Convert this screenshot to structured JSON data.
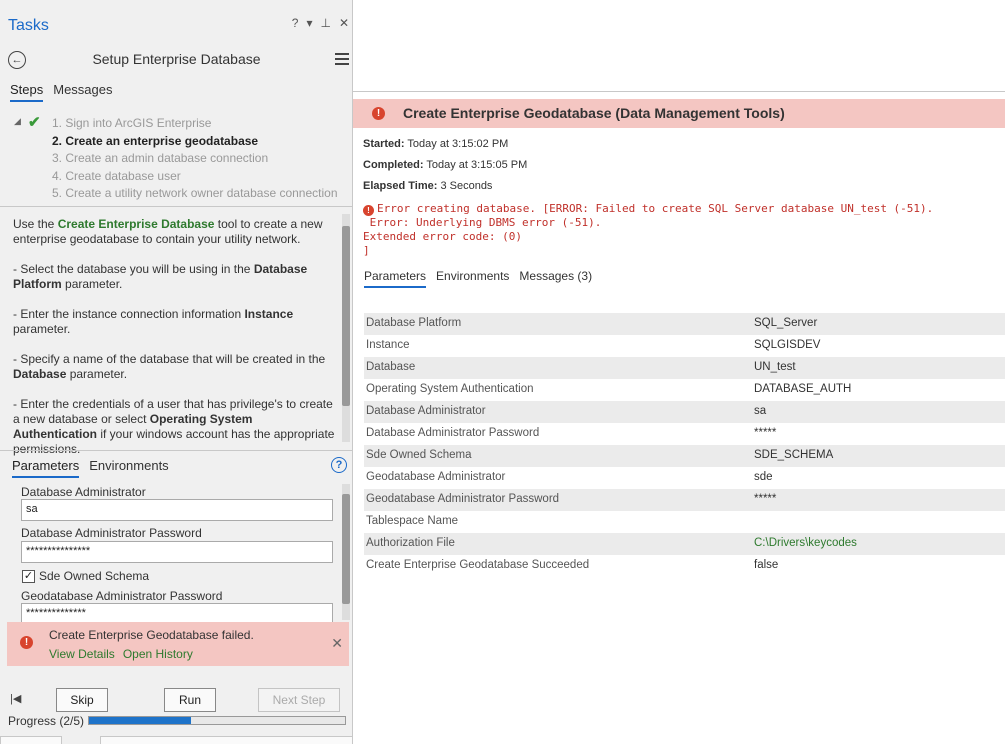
{
  "tasks_pane": {
    "title": "Tasks",
    "header_icons": [
      "?",
      "▾",
      "⊥",
      "✕"
    ],
    "task_title": "Setup Enterprise Database",
    "tabs": [
      "Steps",
      "Messages"
    ],
    "steps": [
      {
        "label": "1.  Sign into ArcGIS Enterprise",
        "state": "done"
      },
      {
        "label": "2.  Create an enterprise geodatabase",
        "state": "current"
      },
      {
        "label": "3.  Create an admin database connection",
        "state": "pending"
      },
      {
        "label": "4.  Create database user",
        "state": "pending"
      },
      {
        "label": "5.  Create a utility network owner database connection",
        "state": "pending"
      }
    ],
    "description": {
      "p1_a": "Use the ",
      "p1_tool": "Create Enterprise Database",
      "p1_b": " tool to create a new enterprise geodatabase to contain your utility network.",
      "p2_a": "- Select the database you will be using in the ",
      "p2_b": "Database Platform",
      "p2_c": " parameter.",
      "p3_a": "- Enter the instance connection information ",
      "p3_b": "Instance",
      "p3_c": " parameter.",
      "p4_a": "- Specify a name of the database that will be created in the ",
      "p4_b": "Database",
      "p4_c": " parameter.",
      "p5_a": "- Enter the credentials of a user that has privilege's to create a new database or select ",
      "p5_b": "Operating System Authentication",
      "p5_c": " if your windows account has the appropriate permissions."
    },
    "param_tabs": [
      "Parameters",
      "Environments"
    ],
    "help_glyph": "?",
    "params": {
      "db_admin_label": "Database Administrator",
      "db_admin_value": "sa",
      "db_admin_pw_label": "Database Administrator Password",
      "db_admin_pw_value": "***************",
      "sde_schema_label": "Sde Owned Schema",
      "sde_schema_checked": "✓",
      "gdb_admin_pw_label": "Geodatabase Administrator Password",
      "gdb_admin_pw_value": "**************"
    },
    "error_banner": {
      "message": "Create Enterprise Geodatabase failed.",
      "view_details": "View Details",
      "open_history": "Open History",
      "close": "✕",
      "icon": "!"
    },
    "buttons": {
      "first": "|◀",
      "skip": "Skip",
      "run": "Run",
      "next": "Next Step"
    },
    "progress": {
      "label": "Progress (2/5)",
      "fraction": 0.4
    }
  },
  "result_pane": {
    "icon": "!",
    "title": "Create Enterprise Geodatabase (Data Management Tools)",
    "started_label": "Started:",
    "started_value": "Today at 3:15:02 PM",
    "completed_label": "Completed:",
    "completed_value": "Today at 3:15:05 PM",
    "elapsed_label": "Elapsed Time:",
    "elapsed_value": "3 Seconds",
    "error_lines": [
      "Error creating database. [ERROR: Failed to create SQL Server database UN_test (-51).",
      " Error: Underlying DBMS error (-51).",
      "Extended error code: (0)",
      "]"
    ],
    "tabs": [
      "Parameters",
      "Environments",
      "Messages (3)"
    ],
    "parameters": [
      {
        "name": "Database Platform",
        "value": "SQL_Server"
      },
      {
        "name": "Instance",
        "value": "SQLGISDEV"
      },
      {
        "name": "Database",
        "value": "UN_test"
      },
      {
        "name": "Operating System Authentication",
        "value": "DATABASE_AUTH"
      },
      {
        "name": "Database Administrator",
        "value": "sa"
      },
      {
        "name": "Database Administrator Password",
        "value": "*****"
      },
      {
        "name": "Sde Owned Schema",
        "value": "SDE_SCHEMA"
      },
      {
        "name": "Geodatabase Administrator",
        "value": "sde"
      },
      {
        "name": "Geodatabase Administrator Password",
        "value": "*****"
      },
      {
        "name": "Tablespace Name",
        "value": ""
      },
      {
        "name": "Authorization File",
        "value": "C:\\Drivers\\keycodes"
      },
      {
        "name": "Create Enterprise Geodatabase Succeeded",
        "value": "false"
      }
    ]
  }
}
